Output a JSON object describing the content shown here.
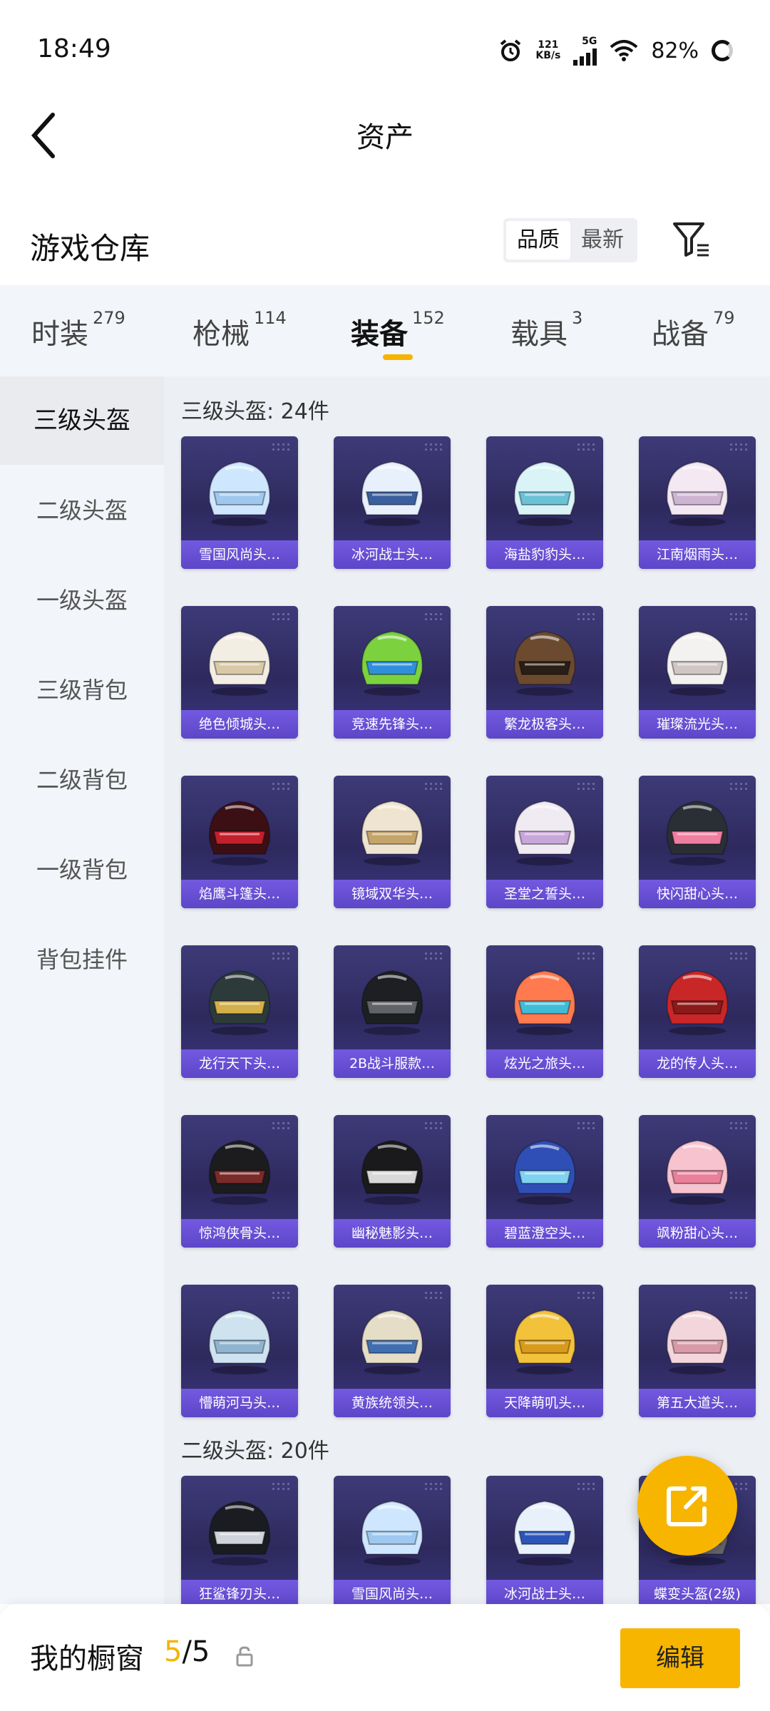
{
  "status": {
    "time": "18:49",
    "net_speed": "121",
    "net_unit": "KB/s",
    "network": "5G",
    "battery": "82%"
  },
  "header": {
    "title": "资产"
  },
  "warehouse": {
    "title": "游戏仓库",
    "sort": [
      "品质",
      "最新"
    ]
  },
  "tabs": [
    {
      "label": "时装",
      "count": "279"
    },
    {
      "label": "枪械",
      "count": "114"
    },
    {
      "label": "装备",
      "count": "152"
    },
    {
      "label": "载具",
      "count": "3"
    },
    {
      "label": "战备",
      "count": "79"
    }
  ],
  "sidebar": [
    "三级头盔",
    "二级头盔",
    "一级头盔",
    "三级背包",
    "二级背包",
    "一级背包",
    "背包挂件"
  ],
  "sections": [
    {
      "title": "三级头盔: 24件",
      "items": [
        "雪国风尚头…",
        "冰河战士头…",
        "海盐豹豹头…",
        "江南烟雨头…",
        "绝色倾城头…",
        "竞速先锋头…",
        "繁龙极客头…",
        "璀璨流光头…",
        "焰鹰斗篷头…",
        "镜域双华头…",
        "圣堂之誓头…",
        "快闪甜心头…",
        "龙行天下头…",
        "2B战斗服款…",
        "炫光之旅头…",
        "龙的传人头…",
        "惊鸿侠骨头…",
        "幽秘魅影头…",
        "碧蓝澄空头…",
        "飒粉甜心头…",
        "懵萌河马头…",
        "黄族统领头…",
        "天降萌叽头…",
        "第五大道头…"
      ]
    },
    {
      "title": "二级头盔: 20件",
      "items": [
        "狂鲨锋刃头…",
        "雪国风尚头…",
        "冰河战士头…",
        "蝶变头盔(2级)"
      ]
    }
  ],
  "bottom": {
    "title": "我的橱窗",
    "current": "5",
    "total": "/5",
    "edit": "编辑"
  },
  "colors": {
    "accent": "#f7b500",
    "card_label": "#6a52d6",
    "card_bg": "#35306a"
  }
}
